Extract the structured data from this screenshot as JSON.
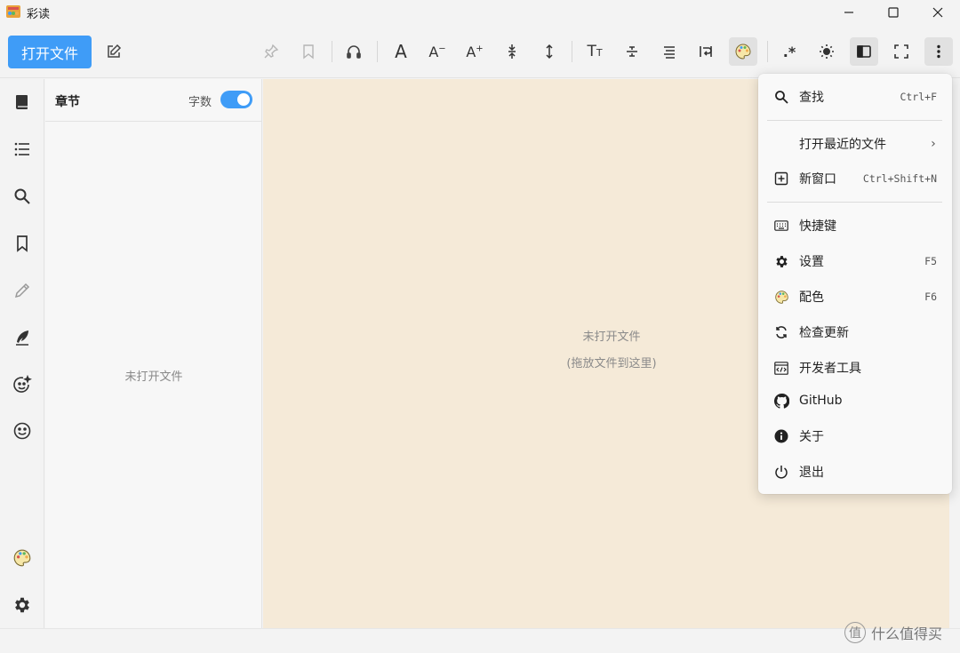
{
  "window": {
    "title": "彩读",
    "app_icon": "palette-app-icon",
    "controls": [
      "minimize-icon",
      "maximize-icon",
      "close-icon"
    ]
  },
  "toolbar": {
    "open_file_label": "打开文件",
    "letters": {
      "font": "A",
      "font_decrease": "A",
      "font_decrease_mark": "−",
      "font_increase": "A",
      "font_increase_mark": "+",
      "font_family": "T",
      "font_family_small": "T"
    },
    "regex_label": ".*"
  },
  "sidebar": {
    "items": [
      "book-icon",
      "list-icon",
      "search-icon",
      "bookmark-icon",
      "pencil-icon",
      "quill-icon",
      "emoji-sparkle-icon",
      "smiley-icon"
    ],
    "bottom_items": [
      "palette-icon",
      "gear-icon"
    ]
  },
  "chapters": {
    "title": "章节",
    "wordcount_label": "字数",
    "wordcount_enabled": true,
    "empty_text": "未打开文件"
  },
  "reader": {
    "empty_line1": "未打开文件",
    "empty_line2": "(拖放文件到这里)"
  },
  "menu": {
    "items": [
      {
        "label": "查找",
        "key": "Ctrl+F"
      },
      {
        "label": "打开最近的文件",
        "key": "›"
      },
      {
        "label": "新窗口",
        "key": "Ctrl+Shift+N"
      },
      {
        "label": "快捷键",
        "key": ""
      },
      {
        "label": "设置",
        "key": "F5"
      },
      {
        "label": "配色",
        "key": "F6"
      },
      {
        "label": "检查更新",
        "key": ""
      },
      {
        "label": "开发者工具",
        "key": ""
      },
      {
        "label": "GitHub",
        "key": ""
      },
      {
        "label": "关于",
        "key": ""
      },
      {
        "label": "退出",
        "key": ""
      }
    ]
  },
  "watermark": {
    "text": "什么值得买",
    "mark": "值"
  },
  "colors": {
    "accent": "#3f9cf7",
    "reader_bg": "#f5ead8",
    "chrome_bg": "#f3f3f3"
  }
}
